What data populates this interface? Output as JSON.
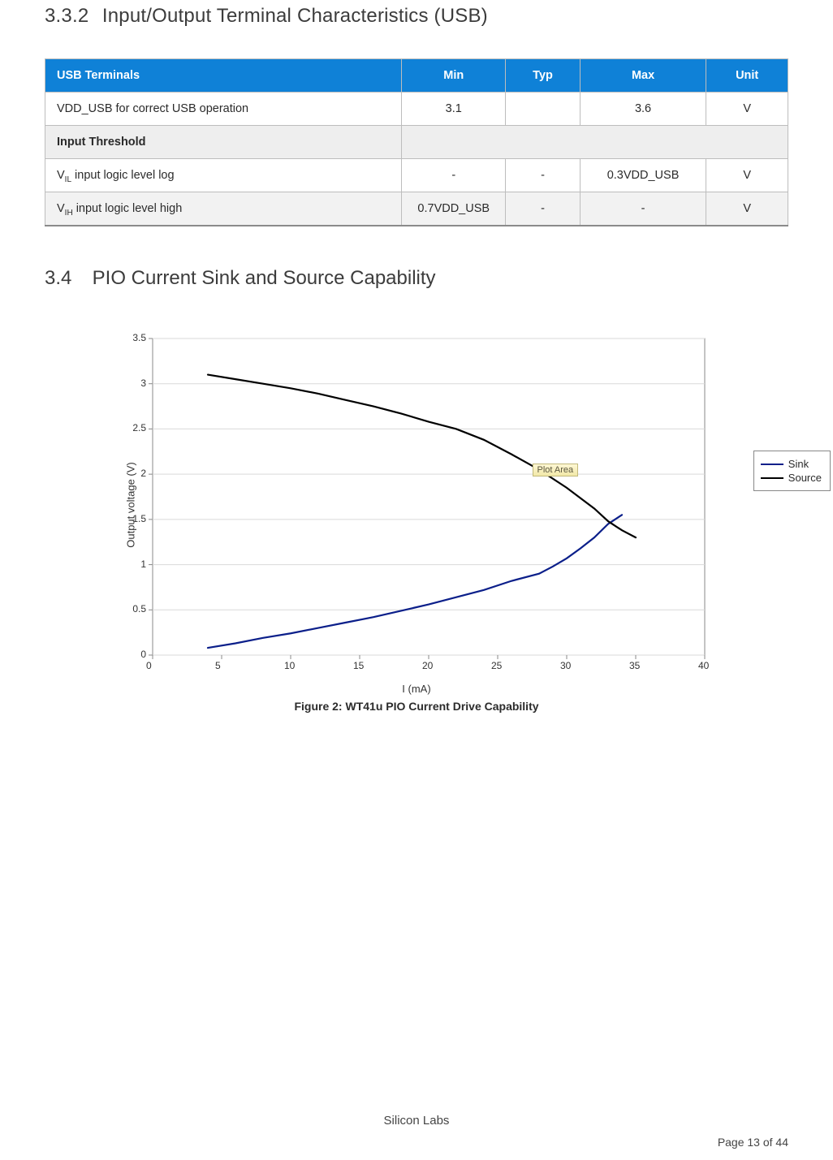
{
  "headings": {
    "h332_num": "3.3.2",
    "h332_title": "Input/Output Terminal Characteristics (USB)",
    "h34_num": "3.4",
    "h34_title": "PIO Current Sink and Source Capability"
  },
  "table": {
    "header": {
      "param": "USB Terminals",
      "min": "Min",
      "typ": "Typ",
      "max": "Max",
      "unit": "Unit"
    },
    "rows": [
      {
        "param": "VDD_USB for correct USB operation",
        "min": "3.1",
        "typ": "",
        "max": "3.6",
        "unit": "V",
        "alt": false
      },
      {
        "subheader": "Input Threshold"
      },
      {
        "html_param": "V<sub>IL</sub> input logic level log",
        "min": "-",
        "typ": "-",
        "max": "0.3VDD_USB",
        "unit": "V",
        "alt": false
      },
      {
        "html_param": "V<sub>IH</sub> input logic level high",
        "min": "0.7VDD_USB",
        "typ": "-",
        "max": "-",
        "unit": "V",
        "alt": true
      }
    ]
  },
  "chart_data": {
    "type": "line",
    "title": "",
    "xlabel": "I (mA)",
    "ylabel": "Output voltage (V)",
    "xlim": [
      0,
      40
    ],
    "ylim": [
      0,
      3.5
    ],
    "xticks": [
      0,
      5,
      10,
      15,
      20,
      25,
      30,
      35,
      40
    ],
    "yticks": [
      0,
      0.5,
      1,
      1.5,
      2,
      2.5,
      3,
      3.5
    ],
    "annotation": {
      "text": "Plot Area",
      "x": 27.5,
      "y": 2.05
    },
    "legend_position": "right",
    "series": [
      {
        "name": "Sink",
        "color": "#0b1f8a",
        "points": [
          {
            "x": 4,
            "y": 0.08
          },
          {
            "x": 6,
            "y": 0.13
          },
          {
            "x": 8,
            "y": 0.19
          },
          {
            "x": 10,
            "y": 0.24
          },
          {
            "x": 12,
            "y": 0.3
          },
          {
            "x": 14,
            "y": 0.36
          },
          {
            "x": 16,
            "y": 0.42
          },
          {
            "x": 18,
            "y": 0.49
          },
          {
            "x": 20,
            "y": 0.56
          },
          {
            "x": 22,
            "y": 0.64
          },
          {
            "x": 24,
            "y": 0.72
          },
          {
            "x": 26,
            "y": 0.82
          },
          {
            "x": 28,
            "y": 0.9
          },
          {
            "x": 29,
            "y": 0.98
          },
          {
            "x": 30,
            "y": 1.07
          },
          {
            "x": 31,
            "y": 1.18
          },
          {
            "x": 32,
            "y": 1.3
          },
          {
            "x": 33,
            "y": 1.45
          },
          {
            "x": 34,
            "y": 1.55
          }
        ]
      },
      {
        "name": "Source",
        "color": "#000000",
        "points": [
          {
            "x": 4,
            "y": 3.1
          },
          {
            "x": 6,
            "y": 3.05
          },
          {
            "x": 8,
            "y": 3.0
          },
          {
            "x": 10,
            "y": 2.95
          },
          {
            "x": 12,
            "y": 2.89
          },
          {
            "x": 14,
            "y": 2.82
          },
          {
            "x": 16,
            "y": 2.75
          },
          {
            "x": 18,
            "y": 2.67
          },
          {
            "x": 20,
            "y": 2.58
          },
          {
            "x": 22,
            "y": 2.5
          },
          {
            "x": 24,
            "y": 2.38
          },
          {
            "x": 26,
            "y": 2.22
          },
          {
            "x": 28,
            "y": 2.05
          },
          {
            "x": 30,
            "y": 1.85
          },
          {
            "x": 32,
            "y": 1.62
          },
          {
            "x": 33,
            "y": 1.48
          },
          {
            "x": 34,
            "y": 1.38
          },
          {
            "x": 35,
            "y": 1.3
          }
        ]
      }
    ]
  },
  "figure_caption": "Figure 2: WT41u PIO Current Drive Capability",
  "footer_company": "Silicon Labs",
  "footer_page": "Page 13 of 44"
}
